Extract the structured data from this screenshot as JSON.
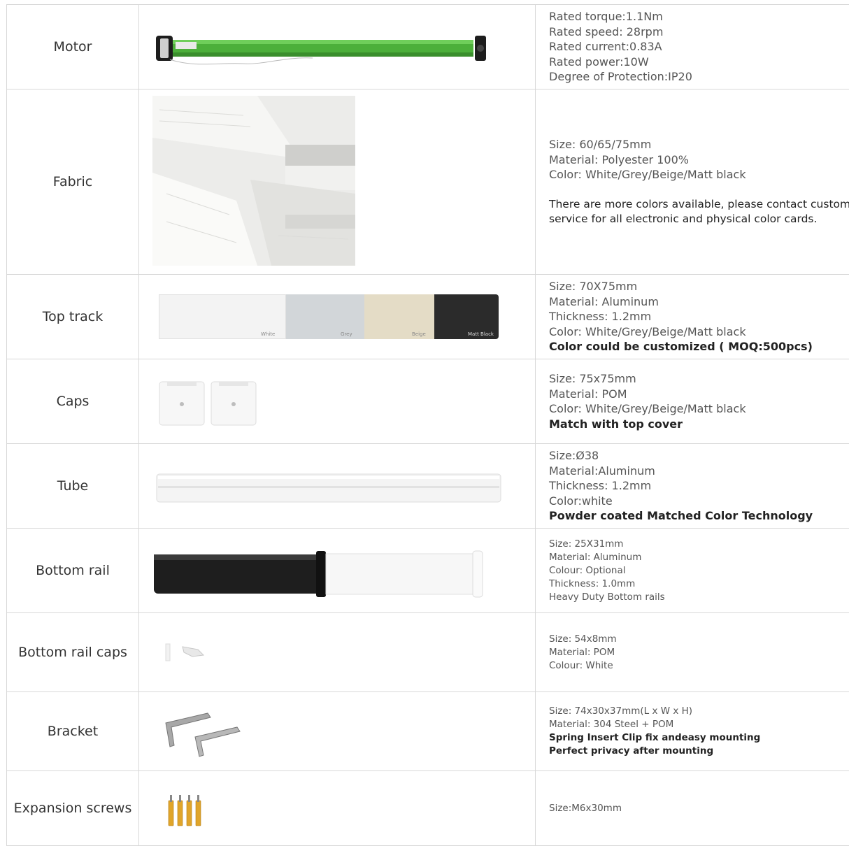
{
  "rows": [
    {
      "name": "Motor",
      "specs": [
        "Rated torque:1.1Nm",
        "Rated speed: 28rpm",
        "Rated current:0.83A",
        "Rated power:10W",
        "Degree of Protection:IP20"
      ]
    },
    {
      "name": "Fabric",
      "specs": [
        "Size: 60/65/75mm",
        "Material: Polyester 100%",
        "Color: White/Grey/Beige/Matt black"
      ],
      "note": "There are more colors available, please contact customer service for all electronic and physical color cards."
    },
    {
      "name": "Top track",
      "specs": [
        "Size: 70X75mm",
        "Material: Aluminum",
        "Thickness: 1.2mm",
        "Color: White/Grey/Beige/Matt black"
      ],
      "bold": "Color could be customized ( MOQ:500pcs)",
      "swatches": [
        "White",
        "Grey",
        "Beige",
        "Matt Black"
      ]
    },
    {
      "name": "Caps",
      "specs": [
        "Size: 75x75mm",
        "Material: POM",
        "Color: White/Grey/Beige/Matt black"
      ],
      "bold": "Match with top cover"
    },
    {
      "name": "Tube",
      "specs": [
        "Size:Ø38",
        "Material:Aluminum",
        "Thickness: 1.2mm",
        "Color:white"
      ],
      "bold": "Powder coated Matched Color Technology"
    },
    {
      "name": "Bottom rail",
      "specs": [
        "Size: 25X31mm",
        "Material: Aluminum",
        "Colour: Optional",
        "Thickness: 1.0mm",
        "Heavy Duty Bottom rails"
      ]
    },
    {
      "name": "Bottom rail caps",
      "specs": [
        "Size: 54x8mm",
        "Material: POM",
        "Colour: White"
      ]
    },
    {
      "name": "Bracket",
      "specs": [
        "Size: 74x30x37mm(L x W x H)",
        "Material: 304 Steel + POM"
      ],
      "bold_lines": [
        "Spring Insert Clip fix andeasy mounting",
        "Perfect privacy after mounting"
      ]
    },
    {
      "name": "Expansion screws",
      "specs": [
        "Size:M6x30mm"
      ]
    }
  ],
  "colors": {
    "border": "#d8d8d8",
    "motor_green": "#4caf3a",
    "matt_black": "#2b2b2b"
  }
}
